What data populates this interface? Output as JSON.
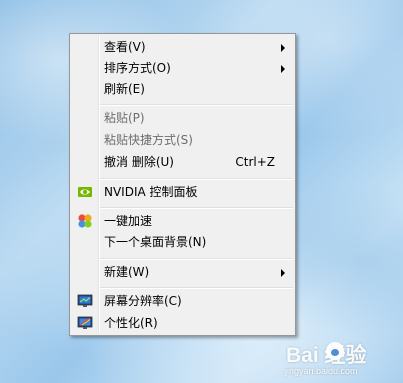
{
  "context_menu": {
    "items": [
      {
        "label": "查看(V)",
        "has_submenu": true,
        "enabled": true
      },
      {
        "label": "排序方式(O)",
        "has_submenu": true,
        "enabled": true
      },
      {
        "label": "刷新(E)",
        "enabled": true
      },
      {
        "label": "粘贴(P)",
        "enabled": false
      },
      {
        "label": "粘贴快捷方式(S)",
        "enabled": false
      },
      {
        "label": "撤消 删除(U)",
        "shortcut": "Ctrl+Z",
        "enabled": true
      },
      {
        "label": "NVIDIA 控制面板",
        "icon": "nvidia-icon",
        "enabled": true
      },
      {
        "label": "一键加速",
        "icon": "accelerate-icon",
        "enabled": true
      },
      {
        "label": "下一个桌面背景(N)",
        "enabled": true
      },
      {
        "label": "新建(W)",
        "has_submenu": true,
        "enabled": true
      },
      {
        "label": "屏幕分辨率(C)",
        "icon": "screen-resolution-icon",
        "enabled": true
      },
      {
        "label": "个性化(R)",
        "icon": "personalize-icon",
        "enabled": true
      }
    ]
  },
  "watermark": {
    "logo_text": "Bai  经验",
    "site": "jingyan.baidu.com"
  },
  "colors": {
    "menu_background": "#f0f0f0",
    "menu_border": "#979797",
    "disabled_text": "#6d6d6d",
    "nvidia_green": "#76b900"
  }
}
